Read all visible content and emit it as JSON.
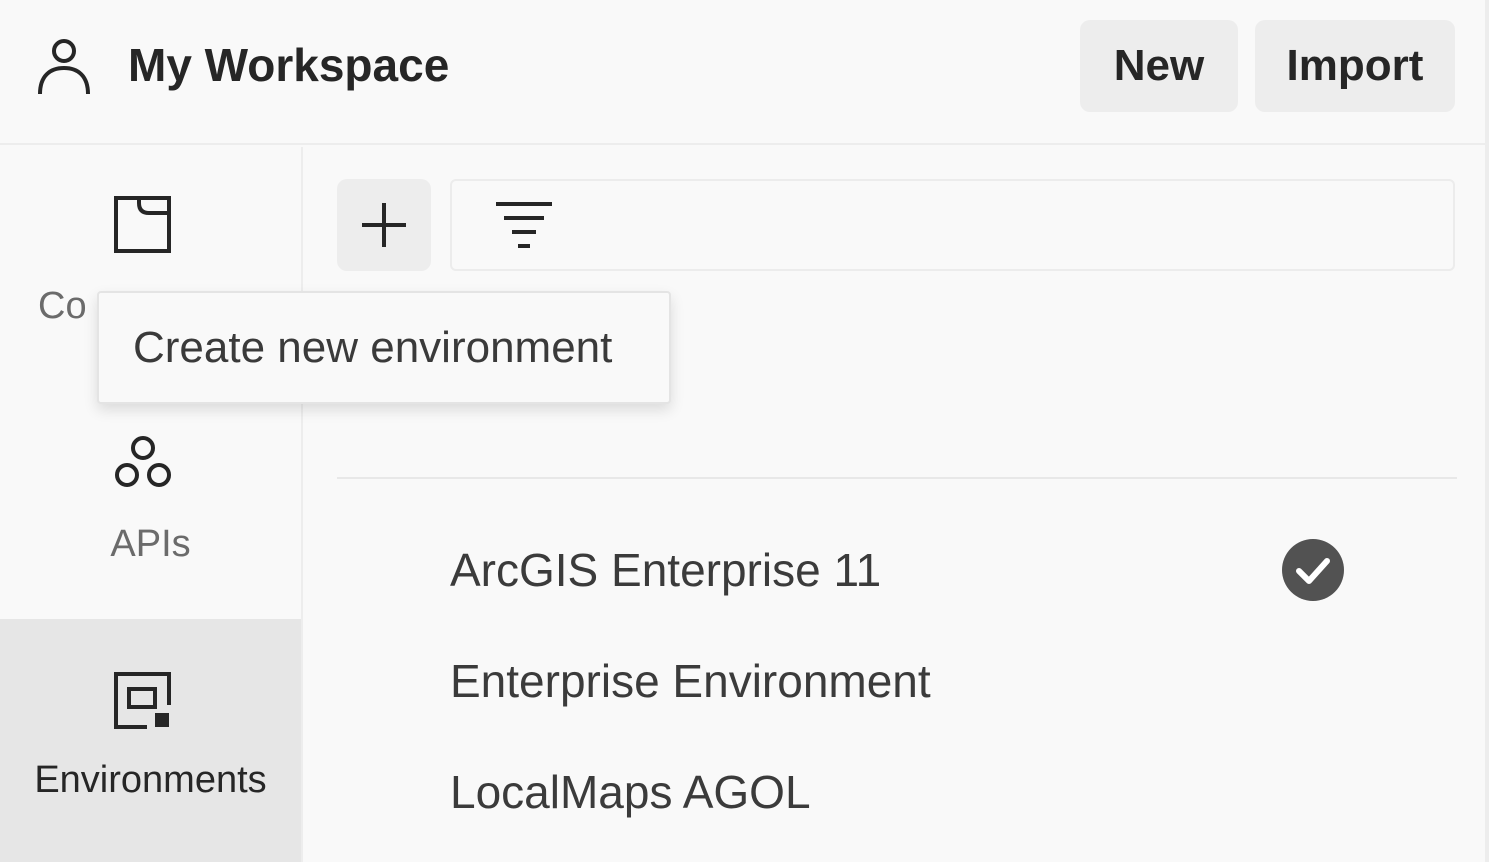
{
  "header": {
    "title": "My Workspace",
    "new_label": "New",
    "import_label": "Import",
    "user_icon": "user-icon"
  },
  "sidebar": {
    "items": [
      {
        "label": "Collections",
        "icon": "collection-icon"
      },
      {
        "label": "APIs",
        "icon": "apis-icon"
      },
      {
        "label": "Environments",
        "icon": "environments-icon",
        "active": true
      }
    ],
    "collections_visible_label": "Co"
  },
  "toolbar": {
    "add_icon": "plus-icon",
    "filter_icon": "filter-icon"
  },
  "tooltip": {
    "text": "Create new environment"
  },
  "environments": [
    {
      "name": "ArcGIS Enterprise 11",
      "active": true
    },
    {
      "name": "Enterprise Environment",
      "active": false
    },
    {
      "name": "LocalMaps AGOL",
      "active": false
    }
  ],
  "colors": {
    "background": "#f9f9f9",
    "button_bg": "#ededed",
    "active_nav_bg": "#e6e6e6",
    "check_fill": "#525252"
  }
}
